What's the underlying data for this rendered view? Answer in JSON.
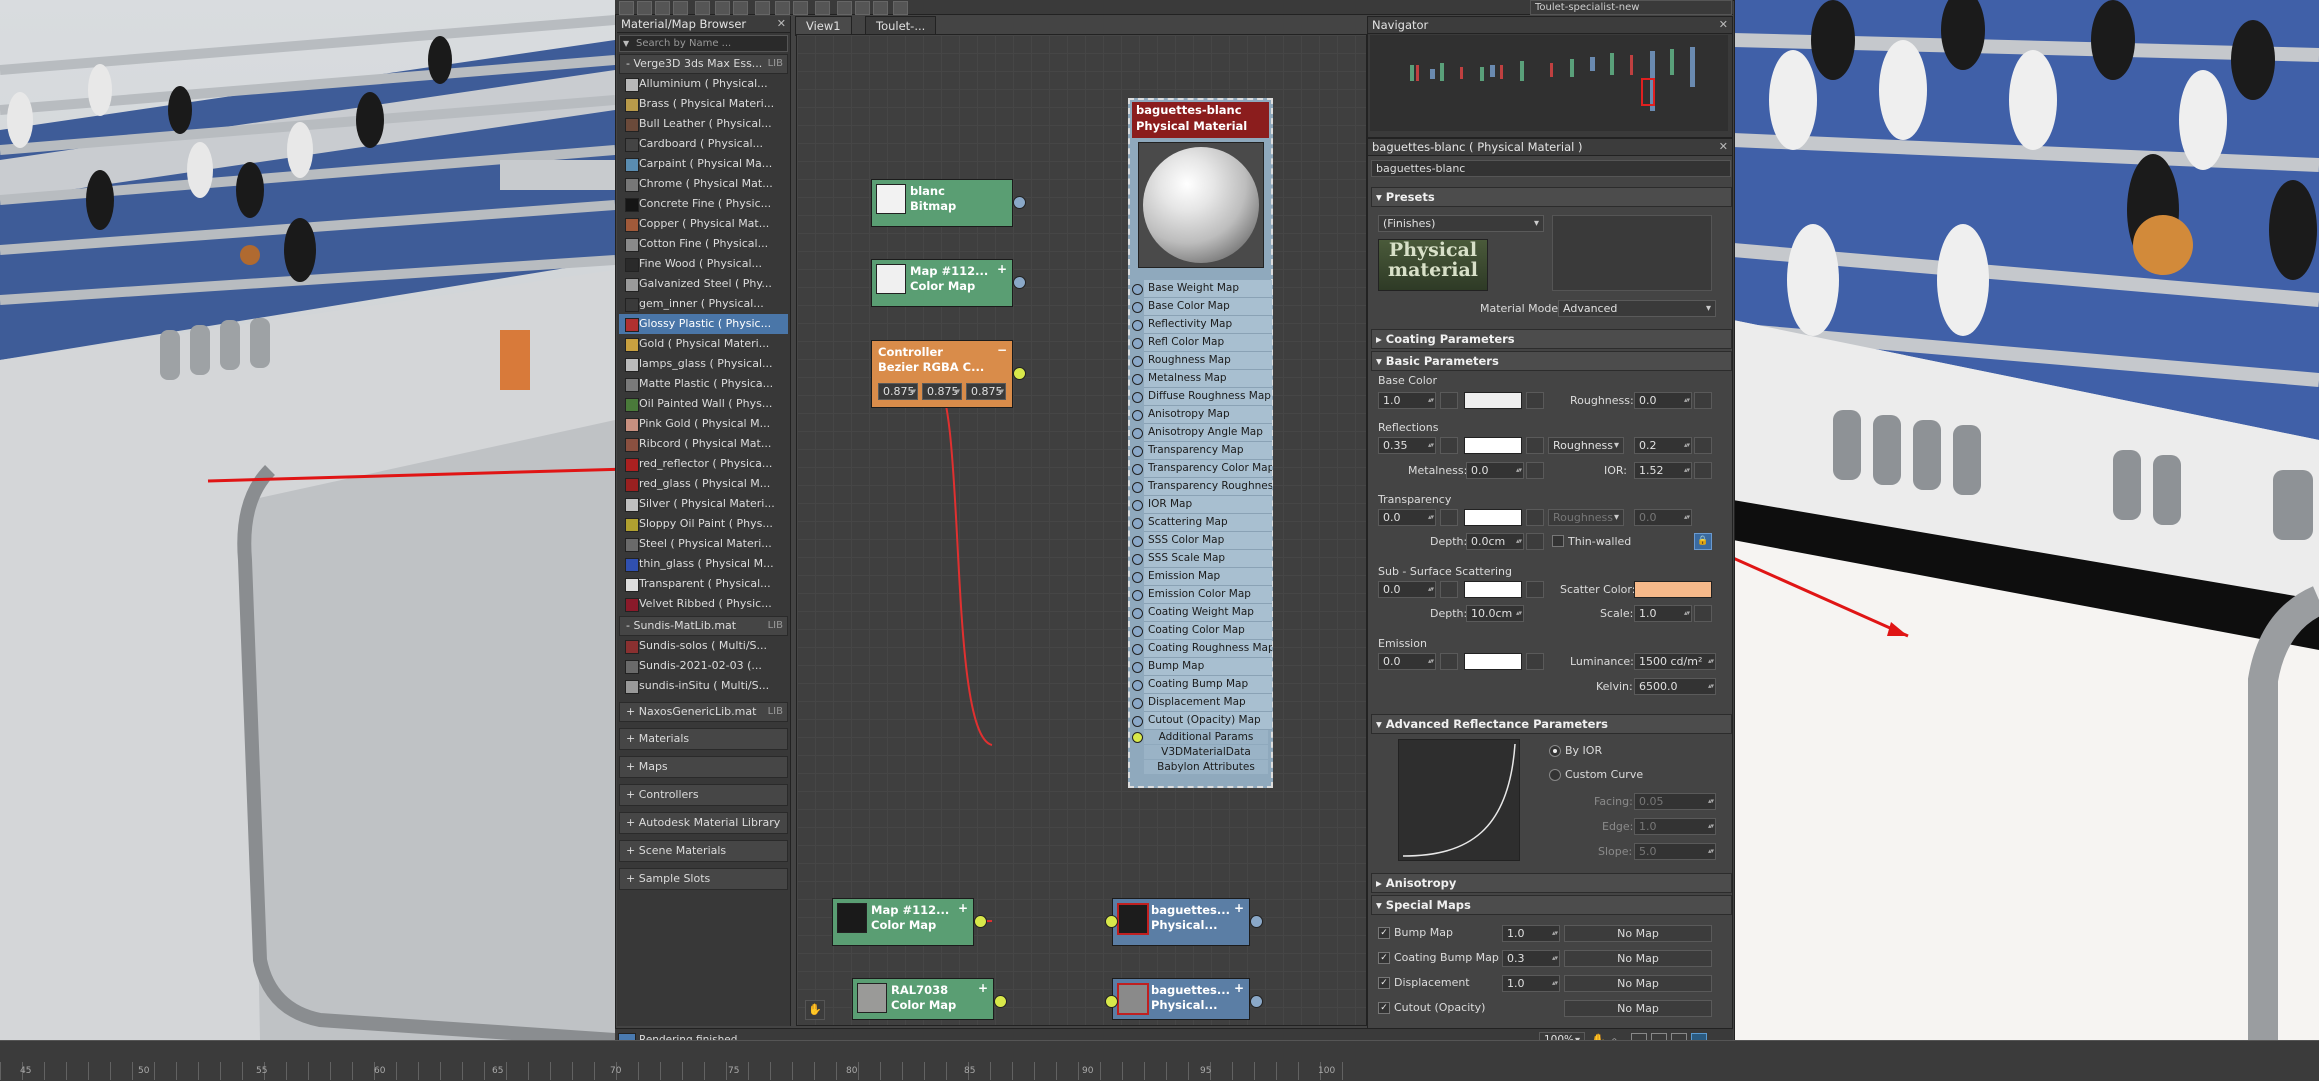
{
  "toolbar": {
    "preset_value": "Toulet-specialist-new"
  },
  "browser": {
    "title": "Material/Map Browser",
    "search_placeholder": "Search by Name ...",
    "lib1": {
      "name": "- Verge3D 3ds Max Ess...",
      "tag": "LIB"
    },
    "materials": [
      {
        "label": "Alluminium  ( Physical...",
        "color": "#b8b8b8"
      },
      {
        "label": "Brass  ( Physical Materi...",
        "color": "#b89a4a"
      },
      {
        "label": "Bull Leather  ( Physical...",
        "color": "#6b4a3a"
      },
      {
        "label": "Cardboard  ( Physical...",
        "color": "#444444"
      },
      {
        "label": "Carpaint  ( Physical Ma...",
        "color": "#5a8cb0"
      },
      {
        "label": "Chrome  ( Physical Mat...",
        "color": "#777777"
      },
      {
        "label": "Concrete Fine  ( Physic...",
        "color": "#151515"
      },
      {
        "label": "Copper  ( Physical Mat...",
        "color": "#a05a3a"
      },
      {
        "label": "Cotton Fine  ( Physical...",
        "color": "#8a8a8a"
      },
      {
        "label": "Fine Wood  ( Physical...",
        "color": "#2a2a2a"
      },
      {
        "label": "Galvanized Steel  ( Phy...",
        "color": "#9a9a9a"
      },
      {
        "label": "gem_inner  ( Physical...",
        "color": "#3a3a3a"
      },
      {
        "label": "Glossy Plastic  ( Physic...",
        "color": "#b03030"
      },
      {
        "label": "Gold  ( Physical Materi...",
        "color": "#c8a040"
      },
      {
        "label": "lamps_glass  ( Physical...",
        "color": "#bbbbbb"
      },
      {
        "label": "Matte Plastic  ( Physica...",
        "color": "#7a7a7a"
      },
      {
        "label": "Oil Painted Wall  ( Phys...",
        "color": "#4a7a3a"
      },
      {
        "label": "Pink Gold  ( Physical M...",
        "color": "#c89080"
      },
      {
        "label": "Ribcord  ( Physical Mat...",
        "color": "#8a5040"
      },
      {
        "label": "red_reflector  ( Physica...",
        "color": "#aa2020"
      },
      {
        "label": "red_glass  ( Physical M...",
        "color": "#992020"
      },
      {
        "label": "Silver  ( Physical Materi...",
        "color": "#c0c0c0"
      },
      {
        "label": "Sloppy Oil Paint  ( Phys...",
        "color": "#b0a030"
      },
      {
        "label": "Steel  ( Physical Materi...",
        "color": "#6a6a6a"
      },
      {
        "label": "thin_glass  ( Physical M...",
        "color": "#3050b0"
      },
      {
        "label": "Transparent  ( Physical...",
        "color": "#dddddd"
      },
      {
        "label": "Velvet Ribbed  ( Physic...",
        "color": "#8a1a2a"
      }
    ],
    "lib2": {
      "name": "- Sundis-MatLib.mat",
      "tag": "LIB"
    },
    "sundis": [
      {
        "label": "Sundis-solos  ( Multi/S...",
        "color": "#8a3030"
      },
      {
        "label": "Sundis-2021-02-03  (...",
        "color": "#6a6a6a"
      },
      {
        "label": "sundis-inSitu  ( Multi/S...",
        "color": "#999999"
      }
    ],
    "lib3": {
      "name": "+ NaxosGenericLib.mat",
      "tag": "LIB"
    },
    "categories": [
      "+ Materials",
      "+ Maps",
      "+ Controllers",
      "+ Autodesk Material Library",
      "+ Scene Materials",
      "+ Sample Slots"
    ]
  },
  "tabs": [
    "View1",
    "Toulet-..."
  ],
  "nodes": {
    "blanc": {
      "name": "blanc",
      "type": "Bitmap"
    },
    "map112a": {
      "name": "Map #112...",
      "type": "Color Map"
    },
    "controller": {
      "name": "Controller",
      "type": "Bezier RGBA C...",
      "v1": "0.875",
      "v2": "0.875",
      "v3": "0.875"
    },
    "map112b": {
      "name": "Map #112...",
      "type": "Color Map"
    },
    "ral": {
      "name": "RAL7038",
      "type": "Color Map"
    },
    "bag1": {
      "name": "baguettes...",
      "type": "Physical..."
    },
    "bag2": {
      "name": "baguettes...",
      "type": "Physical..."
    }
  },
  "matnode": {
    "name": "baguettes-blanc",
    "type": "Physical Material",
    "slots": [
      "Base Weight Map",
      "Base Color Map",
      "Reflectivity Map",
      "Refl Color Map",
      "Roughness Map",
      "Metalness Map",
      "Diffuse Roughness Map",
      "Anisotropy Map",
      "Anisotropy Angle Map",
      "Transparency Map",
      "Transparency Color Map",
      "Transparency Roughnes...",
      "IOR Map",
      "Scattering Map",
      "SSS Color Map",
      "SSS Scale Map",
      "Emission Map",
      "Emission Color Map",
      "Coating Weight Map",
      "Coating Color Map",
      "Coating Roughness Map",
      "Bump Map",
      "Coating Bump Map",
      "Displacement Map",
      "Cutout (Opacity) Map"
    ],
    "extra": [
      "Additional Params",
      "V3DMaterialData",
      "Babylon Attributes"
    ]
  },
  "navigator": {
    "title": "Navigator"
  },
  "params": {
    "title": "baguettes-blanc  ( Physical Material )",
    "name_value": "baguettes-blanc",
    "presets": "Presets",
    "finishes": "(Finishes)",
    "logo_text": "Physical material",
    "mode_label": "Material Mode:",
    "mode_value": "Advanced",
    "coating": "Coating Parameters",
    "basic": "Basic Parameters",
    "base_color": "Base Color",
    "base_weight": "1.0",
    "roughness_label": "Roughness:",
    "roughness": "0.0",
    "reflections": "Reflections",
    "refl_weight": "0.35",
    "refl_mode": "Roughness",
    "refl_rough": "0.2",
    "metalness_label": "Metalness:",
    "metalness": "0.0",
    "ior_label": "IOR:",
    "ior": "1.52",
    "transparency": "Transparency",
    "trans_weight": "0.0",
    "trans_mode": "Roughness",
    "trans_rough": "0.0",
    "depth_label": "Depth:",
    "trans_depth": "0.0cm",
    "thin_walled": "Thin-walled",
    "sss": "Sub - Surface Scattering",
    "sss_weight": "0.0",
    "scatter_label": "Scatter Color:",
    "sss_depth": "10.0cm",
    "scale_label": "Scale:",
    "sss_scale": "1.0",
    "emission": "Emission",
    "em_weight": "0.0",
    "lum_label": "Luminance:",
    "luminance": "1500 cd/m²",
    "kelvin_label": "Kelvin:",
    "kelvin": "6500.0",
    "adv_refl": "Advanced Reflectance Parameters",
    "by_ior": "By IOR",
    "custom_curve": "Custom Curve",
    "facing_label": "Facing:",
    "facing": "0.05",
    "edge_label": "Edge:",
    "edge": "1.0",
    "slope_label": "Slope:",
    "slope": "5.0",
    "anisotropy": "Anisotropy",
    "special": "Special Maps",
    "sm": [
      {
        "label": "Bump Map",
        "value": "1.0",
        "map": "No Map"
      },
      {
        "label": "Coating Bump Map",
        "value": "0.3",
        "map": "No Map"
      },
      {
        "label": "Displacement",
        "value": "1.0",
        "map": "No Map"
      },
      {
        "label": "Cutout (Opacity)",
        "value": "",
        "map": "No Map"
      }
    ]
  },
  "status": {
    "text": "Rendering finished",
    "zoom": "100%"
  },
  "timeline": {
    "ticks": [
      "45",
      "50",
      "55",
      "60",
      "65",
      "70",
      "75",
      "80",
      "85",
      "90",
      "95",
      "100"
    ]
  },
  "colors": {
    "scatter": "#f6b98a",
    "base": "#efefef",
    "accent_red": "#e01515"
  }
}
